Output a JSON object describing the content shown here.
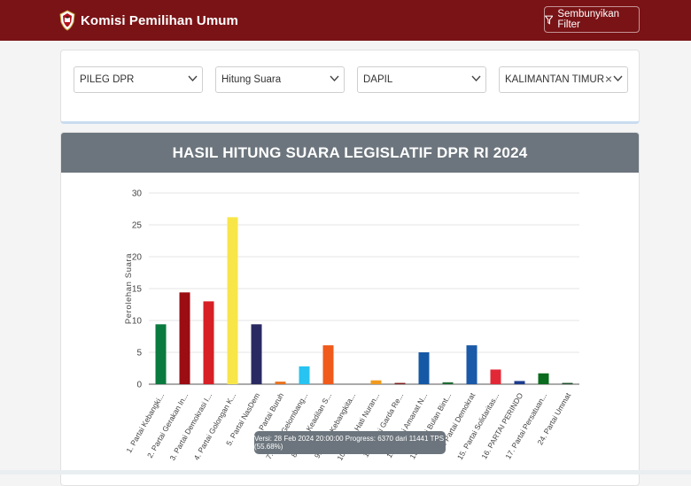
{
  "header": {
    "brand": "Komisi Pemilihan Umum",
    "filter_button": "Sembunyikan Filter"
  },
  "filters": {
    "election_type": "PILEG DPR",
    "mode": "Hitung Suara",
    "region_level": "DAPIL",
    "region": "KALIMANTAN TIMUR"
  },
  "colors": {
    "header_bg": "#7a1316",
    "card_header_bg": "#6c757d"
  },
  "chart_data": {
    "type": "bar",
    "title": "HASIL HITUNG SUARA LEGISLATIF DPR RI 2024",
    "xlabel": "",
    "ylabel": "Perolehan Suara",
    "ylim": [
      0,
      30
    ],
    "yticks": [
      0,
      5,
      10,
      15,
      20,
      25,
      30
    ],
    "grid": true,
    "categories": [
      "1. Partai Kebangki...",
      "2. Partai Gerakan In...",
      "3. Partai Demokrasi I...",
      "4. Partai Golongan K...",
      "5. Partai NasDem",
      "6. Partai Buruh",
      "7. Partai Gelombang...",
      "8. Partai Keadilan S...",
      "9. Partai Kebangkita...",
      "10. Partai Hati Nuran...",
      "11. Partai Garda Re...",
      "12. Partai Amanat N...",
      "13. Partai Bulan Bint...",
      "14. Partai Demokrat",
      "15. Partai Solidaritas...",
      "16. PARTAI PERINDO",
      "17. Partai Persatuan...",
      "24. Partai Ummat"
    ],
    "values": [
      9.4,
      14.4,
      13.0,
      26.2,
      9.4,
      0.4,
      2.8,
      6.1,
      0.0,
      0.6,
      0.2,
      5.0,
      0.3,
      6.1,
      2.3,
      0.5,
      1.7,
      0.2
    ],
    "colors": [
      "#0a7a3e",
      "#9b0c13",
      "#d71f26",
      "#f8e649",
      "#2a2a62",
      "#e8711f",
      "#27c3f1",
      "#f05a1a",
      "#2e8b3e",
      "#f09a1d",
      "#7d1d1d",
      "#1559a6",
      "#1d6b34",
      "#1a5aa8",
      "#e22836",
      "#1c3c8c",
      "#0b6b1e",
      "#1d4d2b"
    ],
    "tooltip": "Versi: 28 Feb 2024 20:00:00 Progress: 6370 dari 11441 TPS (55.68%)"
  }
}
